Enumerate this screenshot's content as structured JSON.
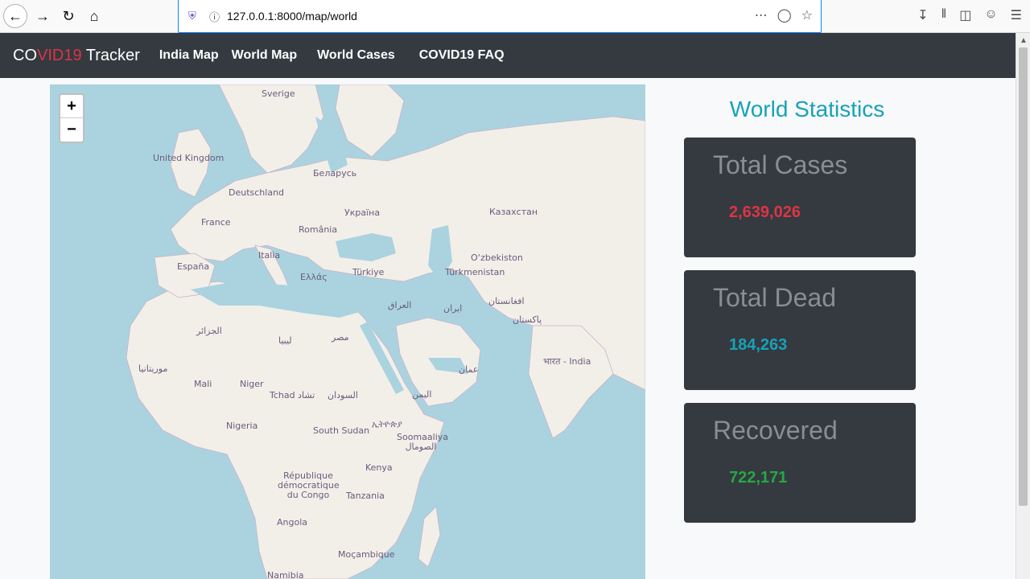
{
  "browser": {
    "url": "127.0.0.1:8000/map/world"
  },
  "navbar": {
    "brand_co": "CO",
    "brand_vid19": "VID19",
    "brand_tracker": " Tracker",
    "links": [
      "India Map",
      "World Map",
      "World Cases",
      "COVID19 FAQ"
    ]
  },
  "map": {
    "zoom_in": "+",
    "zoom_out": "−",
    "labels": [
      "Sverige",
      "United Kingdom",
      "Беларусь",
      "Deutschland",
      "Україна",
      "Казахстан",
      "France",
      "România",
      "España",
      "Italia",
      "O‘zbekiston",
      "Türkiye",
      "Ελλάς",
      "Türkmenistan",
      "العراق",
      "ایران",
      "افغانستان",
      "الجزائر",
      "ليبيا",
      "مصر",
      "پاکستان",
      "भारत - India",
      "موريتانيا",
      "Mali",
      "Niger",
      "Tchad تشاد",
      "السودان",
      "عمان",
      "اليمن",
      "Nigeria",
      "ኢትዮጵያ",
      "South Sudan",
      "Soomaaliya الصومال",
      "Kenya",
      "République démocratique du Congo",
      "Tanzania",
      "Angola",
      "Moçambique",
      "Namibia"
    ]
  },
  "stats": {
    "title": "World Statistics",
    "cards": [
      {
        "label": "Total Cases",
        "value": "2,639,026",
        "color": "#dc3545"
      },
      {
        "label": "Total Dead",
        "value": "184,263",
        "color": "#17a2b8"
      },
      {
        "label": "Recovered",
        "value": "722,171",
        "color": "#28a745"
      }
    ]
  }
}
